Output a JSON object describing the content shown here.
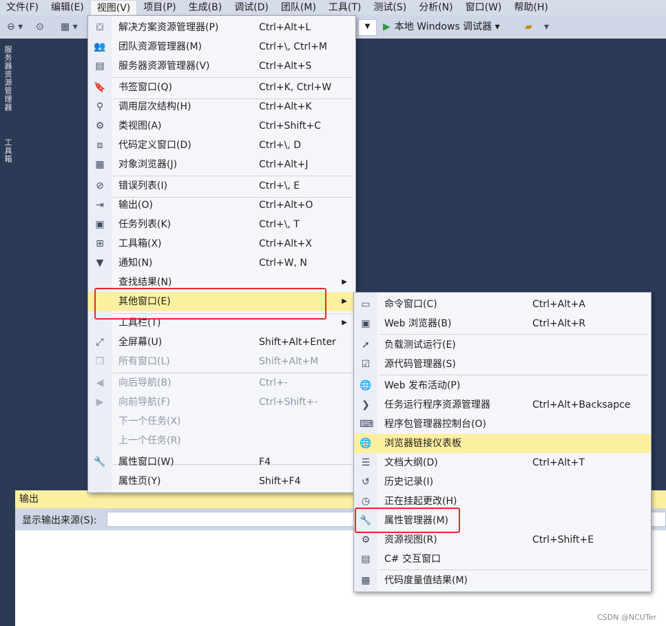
{
  "menubar": [
    "文件(F)",
    "编辑(E)",
    "视图(V)",
    "项目(P)",
    "生成(B)",
    "调试(D)",
    "团队(M)",
    "工具(T)",
    "测试(S)",
    "分析(N)",
    "窗口(W)",
    "帮助(H)"
  ],
  "toolbar": {
    "run_label": "本地 Windows 调试器"
  },
  "left_strip": {
    "tab1": "服务器资源管理器",
    "tab2": "工具箱"
  },
  "view_menu": [
    {
      "icon": "solution-explorer-icon",
      "glyph": "⛋",
      "label": "解决方案资源管理器(P)",
      "shortcut": "Ctrl+Alt+L"
    },
    {
      "icon": "team-explorer-icon",
      "glyph": "👥",
      "label": "团队资源管理器(M)",
      "shortcut": "Ctrl+\\, Ctrl+M"
    },
    {
      "icon": "server-explorer-icon",
      "glyph": "▤",
      "label": "服务器资源管理器(V)",
      "shortcut": "Ctrl+Alt+S"
    },
    {
      "icon": "bookmark-window-icon",
      "glyph": "🔖",
      "label": "书签窗口(Q)",
      "shortcut": "Ctrl+K, Ctrl+W"
    },
    {
      "icon": "call-hierarchy-icon",
      "glyph": "⚲",
      "label": "调用层次结构(H)",
      "shortcut": "Ctrl+Alt+K"
    },
    {
      "icon": "class-view-icon",
      "glyph": "⚙",
      "label": "类视图(A)",
      "shortcut": "Ctrl+Shift+C"
    },
    {
      "icon": "code-definition-icon",
      "glyph": "⧈",
      "label": "代码定义窗口(D)",
      "shortcut": "Ctrl+\\, D"
    },
    {
      "icon": "object-browser-icon",
      "glyph": "▦",
      "label": "对象浏览器(J)",
      "shortcut": "Ctrl+Alt+J"
    },
    {
      "icon": "error-list-icon",
      "glyph": "⊘",
      "label": "错误列表(I)",
      "shortcut": "Ctrl+\\, E"
    },
    {
      "icon": "output-icon",
      "glyph": "⇥",
      "label": "输出(O)",
      "shortcut": "Ctrl+Alt+O"
    },
    {
      "icon": "task-list-icon",
      "glyph": "▣",
      "label": "任务列表(K)",
      "shortcut": "Ctrl+\\, T"
    },
    {
      "icon": "toolbox-icon",
      "glyph": "⊞",
      "label": "工具箱(X)",
      "shortcut": "Ctrl+Alt+X"
    },
    {
      "icon": "notification-icon",
      "glyph": "▼",
      "label": "通知(N)",
      "shortcut": "Ctrl+W, N"
    },
    {
      "icon": "",
      "glyph": "",
      "label": "查找结果(N)",
      "shortcut": "",
      "submenu": true
    },
    {
      "icon": "",
      "glyph": "",
      "label": "其他窗口(E)",
      "shortcut": "",
      "submenu": true,
      "highlight": true
    },
    {
      "icon": "",
      "glyph": "",
      "label": "工具栏(T)",
      "shortcut": "",
      "submenu": true
    },
    {
      "icon": "fullscreen-icon",
      "glyph": "⤢",
      "label": "全屏幕(U)",
      "shortcut": "Shift+Alt+Enter"
    },
    {
      "icon": "all-windows-icon",
      "glyph": "❐",
      "label": "所有窗口(L)",
      "shortcut": "Shift+Alt+M",
      "disabled": true
    },
    {
      "icon": "navigate-back-icon",
      "glyph": "◀",
      "label": "向后导航(B)",
      "shortcut": "Ctrl+-",
      "disabled": true
    },
    {
      "icon": "navigate-forward-icon",
      "glyph": "▶",
      "label": "向前导航(F)",
      "shortcut": "Ctrl+Shift+-",
      "disabled": true
    },
    {
      "icon": "",
      "glyph": "",
      "label": "下一个任务(X)",
      "shortcut": "",
      "disabled": true
    },
    {
      "icon": "",
      "glyph": "",
      "label": "上一个任务(R)",
      "shortcut": "",
      "disabled": true
    },
    {
      "icon": "wrench-icon",
      "glyph": "🔧",
      "label": "属性窗口(W)",
      "shortcut": "F4"
    },
    {
      "icon": "",
      "glyph": "",
      "label": "属性页(Y)",
      "shortcut": "Shift+F4"
    }
  ],
  "sub_menu": [
    {
      "icon": "command-window-icon",
      "glyph": "▭",
      "label": "命令窗口(C)",
      "shortcut": "Ctrl+Alt+A"
    },
    {
      "icon": "web-browser-icon",
      "glyph": "▣",
      "label": "Web 浏览器(B)",
      "shortcut": "Ctrl+Alt+R"
    },
    {
      "icon": "load-test-icon",
      "glyph": "➚",
      "label": "负载测试运行(E)",
      "shortcut": ""
    },
    {
      "icon": "source-control-icon",
      "glyph": "☑",
      "label": "源代码管理器(S)",
      "shortcut": ""
    },
    {
      "icon": "web-publish-icon",
      "glyph": "🌐",
      "label": "Web 发布活动(P)",
      "shortcut": ""
    },
    {
      "icon": "task-runner-icon",
      "glyph": "❯",
      "label": "任务运行程序资源管理器",
      "shortcut": "Ctrl+Alt+Backsapce"
    },
    {
      "icon": "package-console-icon",
      "glyph": "⌨",
      "label": "程序包管理器控制台(O)",
      "shortcut": ""
    },
    {
      "icon": "browser-link-icon",
      "glyph": "🌐",
      "label": "浏览器链接仪表板",
      "shortcut": "",
      "highlight": true
    },
    {
      "icon": "document-outline-icon",
      "glyph": "☰",
      "label": "文档大纲(D)",
      "shortcut": "Ctrl+Alt+T"
    },
    {
      "icon": "history-icon",
      "glyph": "↺",
      "label": "历史记录(I)",
      "shortcut": ""
    },
    {
      "icon": "pending-changes-icon",
      "glyph": "◷",
      "label": "正在挂起更改(H)",
      "shortcut": ""
    },
    {
      "icon": "wrench-icon",
      "glyph": "🔧",
      "label": "属性管理器(M)",
      "shortcut": ""
    },
    {
      "icon": "resource-view-icon",
      "glyph": "⚙",
      "label": "资源视图(R)",
      "shortcut": "Ctrl+Shift+E"
    },
    {
      "icon": "csharp-interactive-icon",
      "glyph": "▤",
      "label": "C# 交互窗口",
      "shortcut": ""
    },
    {
      "icon": "code-metrics-icon",
      "glyph": "▦",
      "label": "代码度量值结果(M)",
      "shortcut": ""
    }
  ],
  "output": {
    "title": "输出",
    "source_label": "显示输出来源(S):"
  },
  "watermark": "CSDN @NCUTer"
}
